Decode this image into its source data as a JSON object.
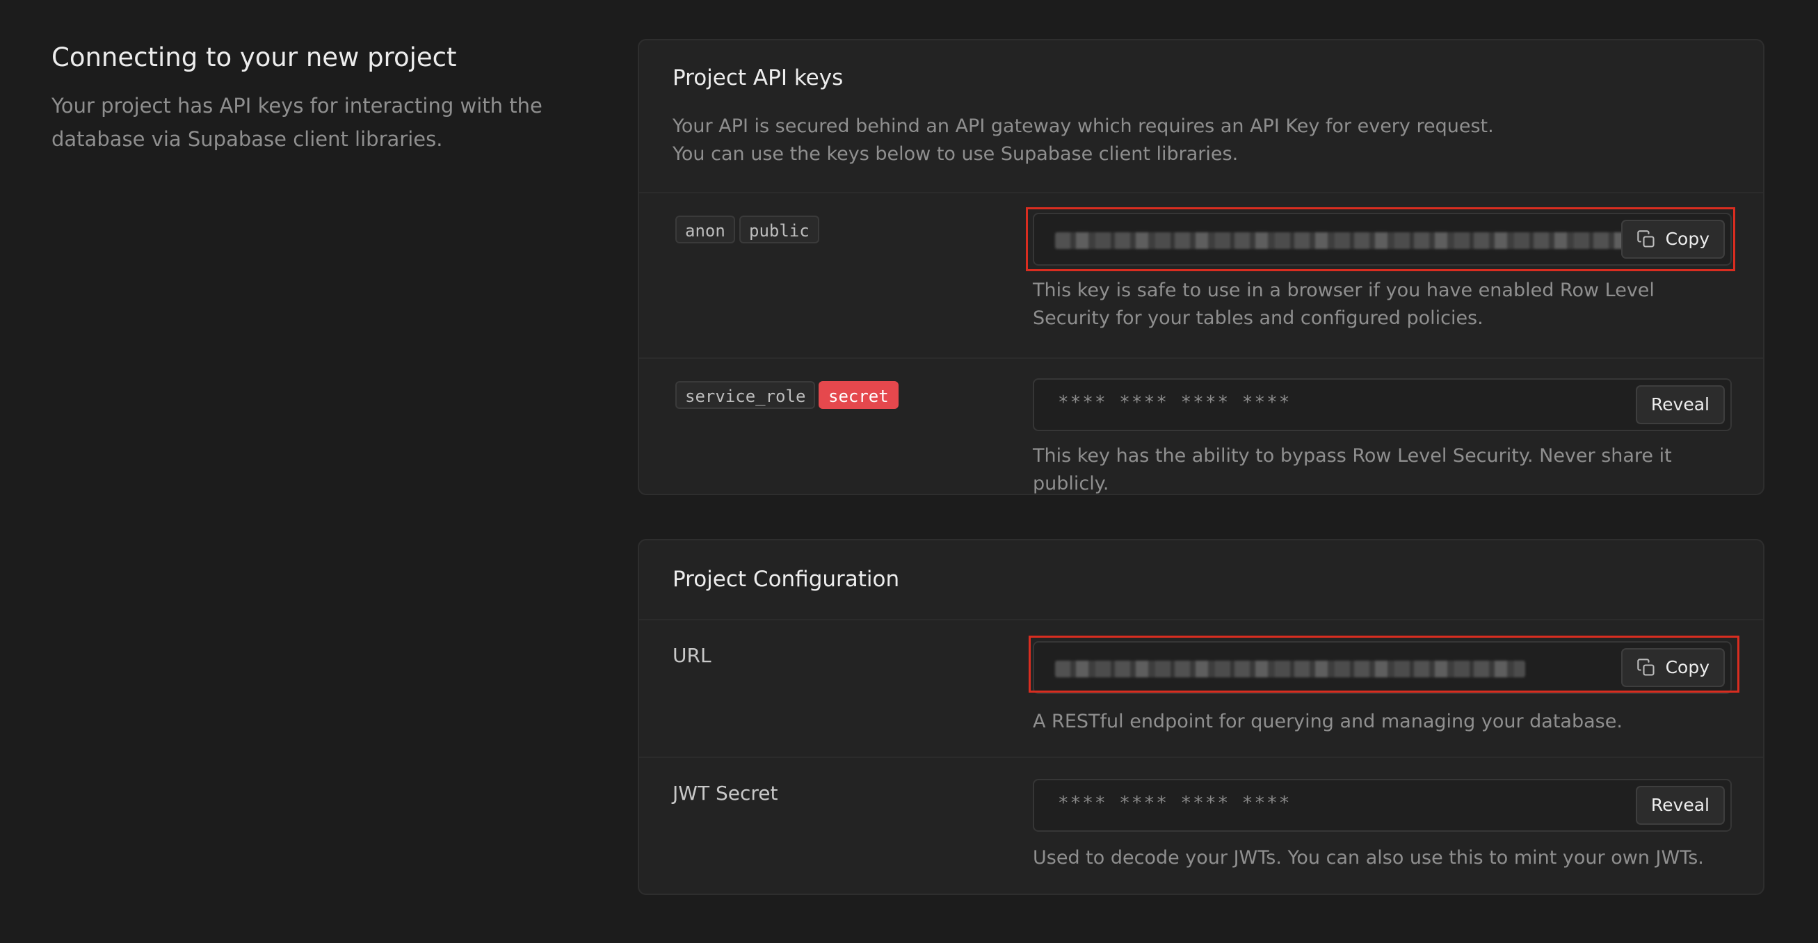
{
  "intro": {
    "title": "Connecting to your new project",
    "description": "Your project has API keys for interacting with the database via Supabase client libraries."
  },
  "api_keys": {
    "title": "Project API keys",
    "description_line1": "Your API is secured behind an API gateway which requires an API Key for every request.",
    "description_line2": "You can use the keys below to use Supabase client libraries.",
    "anon": {
      "tags": [
        "anon",
        "public"
      ],
      "value_redacted": true,
      "button_label": "Copy",
      "help": "This key is safe to use in a browser if you have enabled Row Level Security for your tables and configured policies."
    },
    "service_role": {
      "tags": [
        "service_role",
        "secret"
      ],
      "masked_value": "**** **** **** ****",
      "button_label": "Reveal",
      "help": "This key has the ability to bypass Row Level Security. Never share it publicly."
    }
  },
  "config": {
    "title": "Project Configuration",
    "url": {
      "label": "URL",
      "value_redacted": true,
      "button_label": "Copy",
      "help": "A RESTful endpoint for querying and managing your database."
    },
    "jwt": {
      "label": "JWT Secret",
      "masked_value": "**** **** **** ****",
      "button_label": "Reveal",
      "help": "Used to decode your JWTs. You can also use this to mint your own JWTs."
    }
  },
  "colors": {
    "background": "#1c1c1c",
    "panel": "#232323",
    "secret_badge": "#e5484d",
    "highlight_border": "#d92d20"
  },
  "icons": {
    "copy": "copy-icon"
  }
}
